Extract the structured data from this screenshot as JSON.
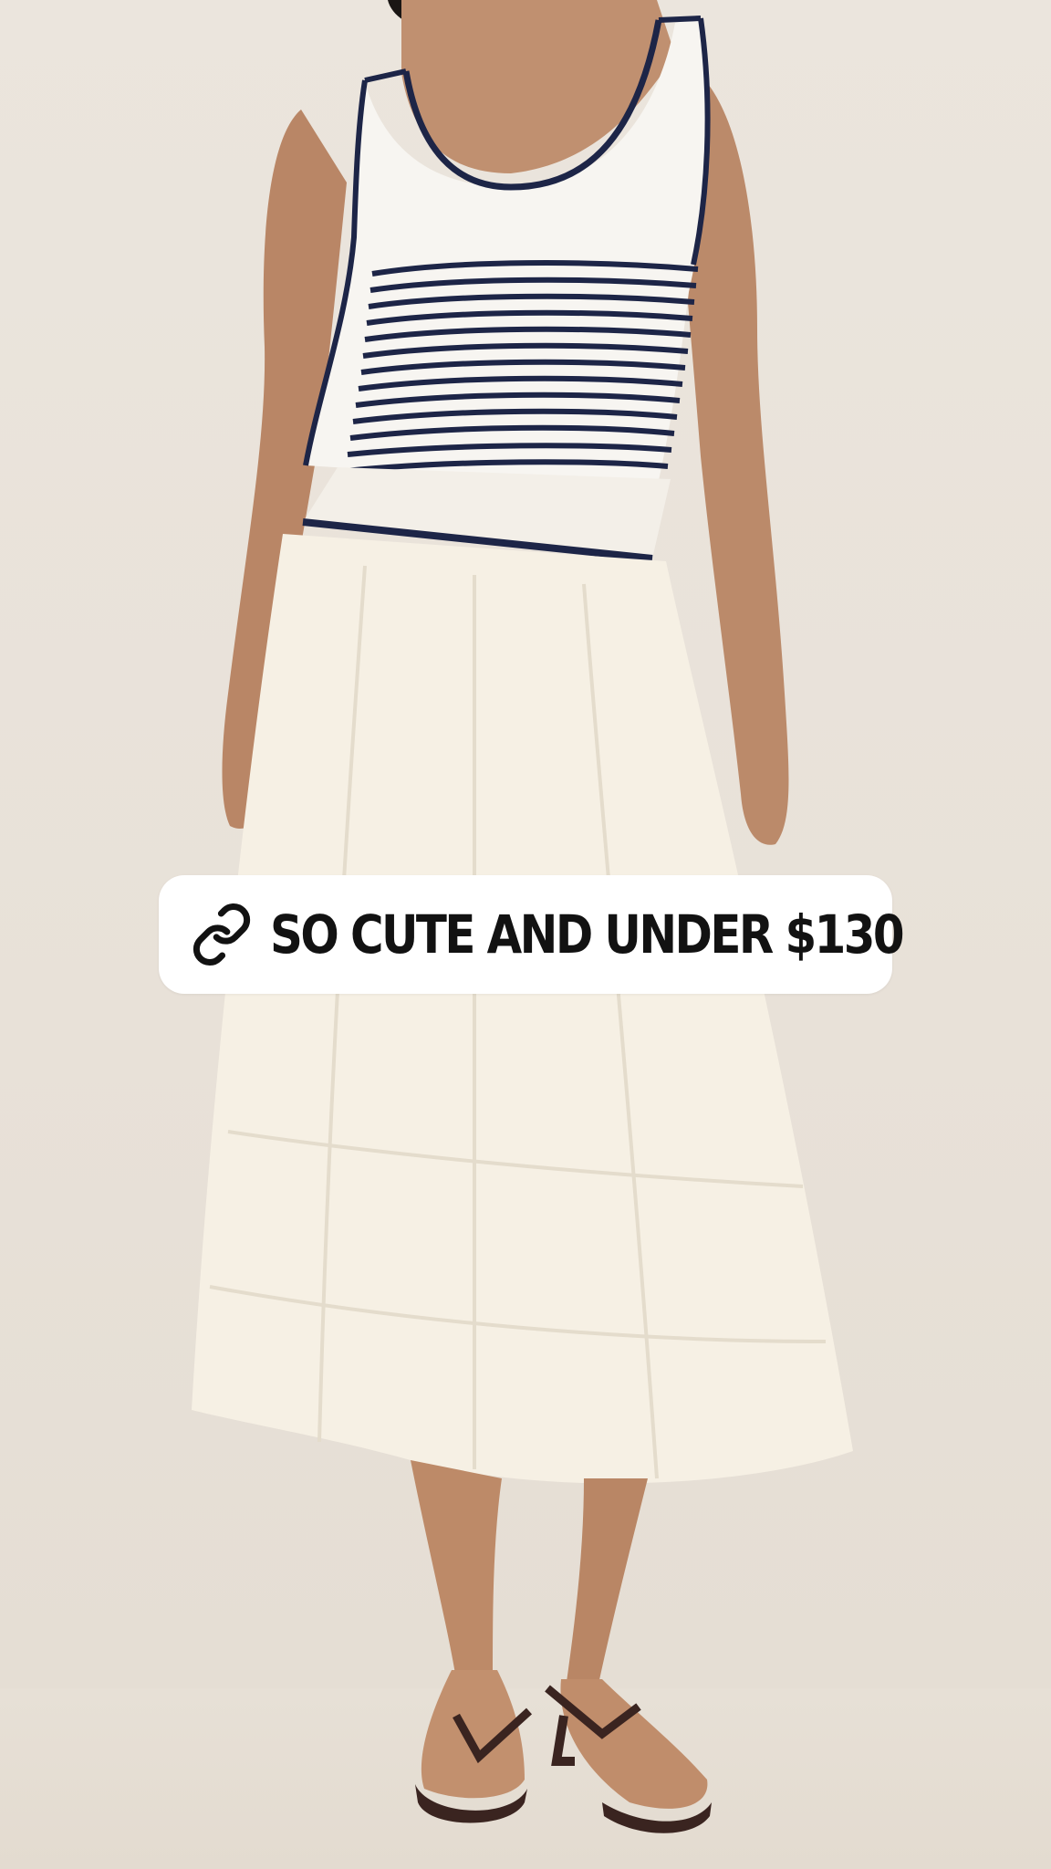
{
  "story": {
    "link_sticker": {
      "icon": "link-icon",
      "label": "SO CUTE AND UNDER $130"
    }
  },
  "colors": {
    "background": "#e9e3db",
    "sticker_bg": "#ffffff",
    "sticker_text": "#121212",
    "stripe_navy": "#1d2547",
    "skirt_cream": "#f7f1e6"
  }
}
